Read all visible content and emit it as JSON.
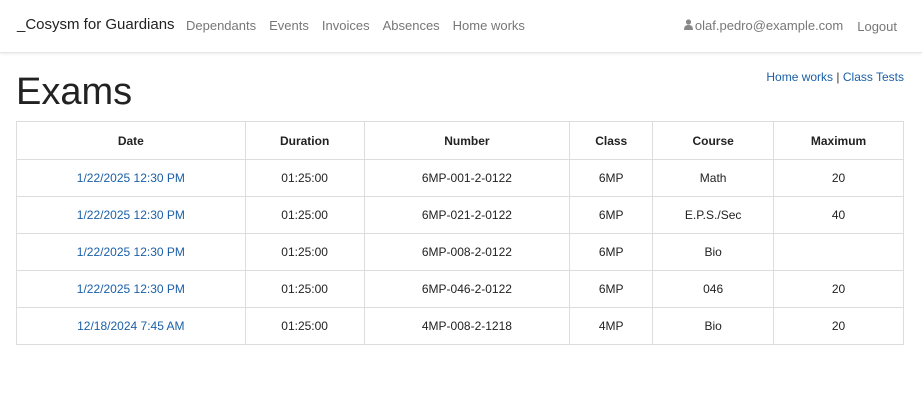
{
  "navbar": {
    "brand": "_Cosysm for Guardians",
    "links": [
      "Dependants",
      "Events",
      "Invoices",
      "Absences",
      "Home works"
    ],
    "user_email": "olaf.pedro@example.com",
    "logout": "Logout"
  },
  "page": {
    "title": "Exams",
    "side_links": {
      "home_works": "Home works",
      "separator": " | ",
      "class_tests": "Class Tests"
    }
  },
  "table": {
    "headers": [
      "Date",
      "Duration",
      "Number",
      "Class",
      "Course",
      "Maximum"
    ],
    "rows": [
      {
        "date": "1/22/2025 12:30 PM",
        "duration": "01:25:00",
        "number": "6MP-001-2-0122",
        "class": "6MP",
        "course": "Math",
        "maximum": "20"
      },
      {
        "date": "1/22/2025 12:30 PM",
        "duration": "01:25:00",
        "number": "6MP-021-2-0122",
        "class": "6MP",
        "course": "E.P.S./Sec",
        "maximum": "40"
      },
      {
        "date": "1/22/2025 12:30 PM",
        "duration": "01:25:00",
        "number": "6MP-008-2-0122",
        "class": "6MP",
        "course": "Bio",
        "maximum": ""
      },
      {
        "date": "1/22/2025 12:30 PM",
        "duration": "01:25:00",
        "number": "6MP-046-2-0122",
        "class": "6MP",
        "course": "046",
        "maximum": "20"
      },
      {
        "date": "12/18/2024 7:45 AM",
        "duration": "01:25:00",
        "number": "4MP-008-2-1218",
        "class": "4MP",
        "course": "Bio",
        "maximum": "20"
      }
    ]
  },
  "icons": {
    "user": "user-icon"
  },
  "colors": {
    "link": "#1a5fa8",
    "nav_text": "#777777",
    "border": "#dddddd"
  }
}
